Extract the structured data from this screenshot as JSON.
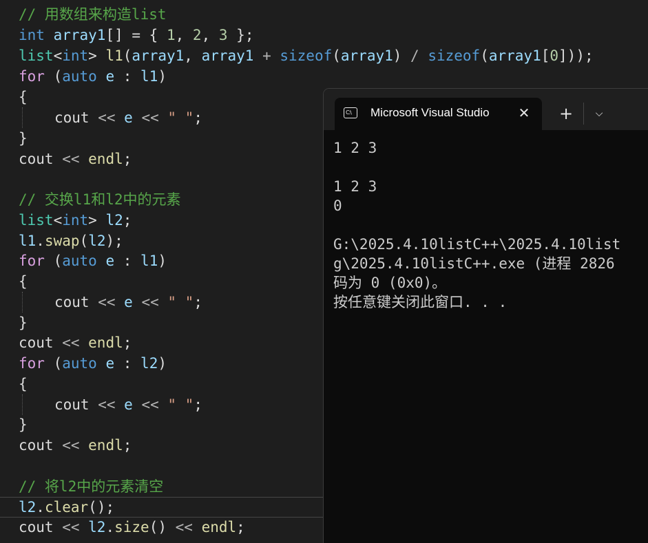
{
  "editor": {
    "line1": {
      "comment": "// 用数组来构造list"
    },
    "line2": {
      "type": "int",
      "name": "array1",
      "brackets": "[] = { ",
      "n1": "1",
      "c1": ", ",
      "n2": "2",
      "c2": ", ",
      "n3": "3",
      "end": " };"
    },
    "line3": {
      "list": "list",
      "lt": "<",
      "int": "int",
      "gt": "> ",
      "l1": "l1",
      "paren": "(",
      "a1": "array1",
      "comma": ", ",
      "a2": "array1",
      "plus": " + ",
      "sizeof1": "sizeof",
      "p2": "(",
      "a3": "array1",
      "p3": ") ",
      "div": "/ ",
      "sizeof2": "sizeof",
      "p4": "(",
      "a4": "array1",
      "br": "[",
      "zero": "0",
      "end": "]));"
    },
    "line4": {
      "for": "for",
      "open": " (",
      "auto": "auto",
      "e": " e",
      "colon": " : ",
      "l1": "l1",
      "close": ")"
    },
    "line5": {
      "brace": "{"
    },
    "line6": {
      "cout": "cout",
      "op1": " << ",
      "e": "e",
      "op2": " << ",
      "str": "\" \"",
      "semi": ";"
    },
    "line7": {
      "brace": "}"
    },
    "line8": {
      "cout": "cout",
      "op": " << ",
      "endl": "endl",
      "semi": ";"
    },
    "line10": {
      "comment": "// 交换l1和l2中的元素"
    },
    "line11": {
      "list": "list",
      "lt": "<",
      "int": "int",
      "gt": "> ",
      "l2": "l2",
      "semi": ";"
    },
    "line12": {
      "l1": "l1",
      "dot": ".",
      "swap": "swap",
      "open": "(",
      "l2": "l2",
      "close": ");"
    },
    "line13": {
      "for": "for",
      "open": " (",
      "auto": "auto",
      "e": " e",
      "colon": " : ",
      "l1": "l1",
      "close": ")"
    },
    "line14": {
      "brace": "{"
    },
    "line15": {
      "cout": "cout",
      "op1": " << ",
      "e": "e",
      "op2": " << ",
      "str": "\" \"",
      "semi": ";"
    },
    "line16": {
      "brace": "}"
    },
    "line17": {
      "cout": "cout",
      "op": " << ",
      "endl": "endl",
      "semi": ";"
    },
    "line18": {
      "for": "for",
      "open": " (",
      "auto": "auto",
      "e": " e",
      "colon": " : ",
      "l2": "l2",
      "close": ")"
    },
    "line19": {
      "brace": "{"
    },
    "line20": {
      "cout": "cout",
      "op1": " << ",
      "e": "e",
      "op2": " << ",
      "str": "\" \"",
      "semi": ";"
    },
    "line21": {
      "brace": "}"
    },
    "line22": {
      "cout": "cout",
      "op": " << ",
      "endl": "endl",
      "semi": ";"
    },
    "line24": {
      "comment": "// 将l2中的元素清空"
    },
    "line25": {
      "l2": "l2",
      "dot": ".",
      "clear": "clear",
      "end": "();"
    },
    "line26": {
      "cout": "cout",
      "op1": " << ",
      "l2": "l2",
      "dot": ".",
      "size": "size",
      "paren": "()",
      "op2": " << ",
      "endl": "endl",
      "semi": ";"
    }
  },
  "console": {
    "tab_title": "Microsoft Visual Studio",
    "tab_icon_glyph": "C:\\",
    "close_glyph": "✕",
    "new_tab_glyph": "+",
    "dropdown_glyph": "⌵",
    "lines": [
      "1 2 3",
      "",
      "1 2 3",
      "0",
      "",
      "G:\\2025.4.10listC++\\2025.4.10list",
      "g\\2025.4.10listC++.exe (进程 2826",
      "码为 0 (0x0)。",
      "按任意键关闭此窗口. . ."
    ]
  },
  "colors": {
    "editor_bg": "#1e1e1e",
    "comment": "#57a64a",
    "keyword": "#569cd6",
    "control_keyword": "#d8a0df",
    "type": "#4ec9b0",
    "variable": "#9cdcfe",
    "function": "#dcdcaa",
    "number": "#b5cea8",
    "string": "#d69d85",
    "console_bg": "#0c0c0c",
    "console_text": "#cccccc"
  }
}
